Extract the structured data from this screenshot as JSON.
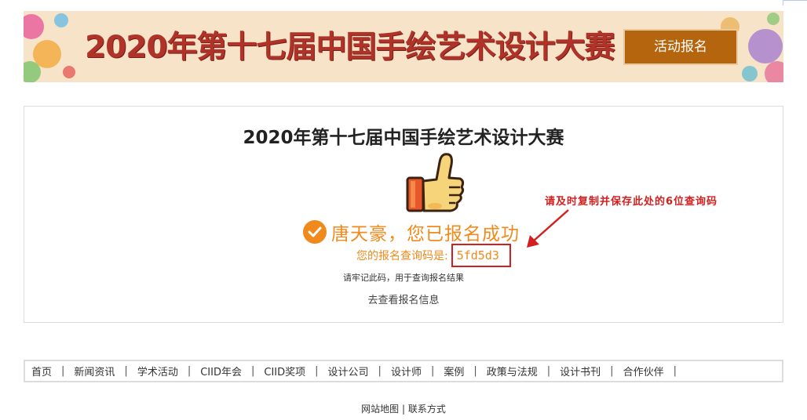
{
  "banner": {
    "title": "2020年第十七届中国手绘艺术设计大赛",
    "button_label": "活动报名",
    "colors": {
      "background": "#f6e3c8",
      "title": "#b0332a",
      "button": "#b5650d"
    }
  },
  "result": {
    "title": "2020年第十七届中国手绘艺术设计大赛",
    "success_message": "唐天豪，您已报名成功",
    "code_label": "您的报名查询码是:",
    "code_value": "5fd5d3",
    "note": "请牢记此码，用于查询报名结果",
    "view_link": "去查看报名信息",
    "annotation": "请及时复制并保存此处的6位查询码",
    "icons": [
      "thumbs-up-icon",
      "checkmark-icon",
      "arrow-icon"
    ],
    "colors": {
      "accent": "#f08a1c",
      "annotation": "#d22020"
    }
  },
  "footer_nav": {
    "items": [
      "首页",
      "新闻资讯",
      "学术活动",
      "CIID年会",
      "CIID奖项",
      "设计公司",
      "设计师",
      "案例",
      "政策与法规",
      "设计书刊",
      "合作伙伴"
    ],
    "separator": "|"
  },
  "bottom_links": {
    "sitemap": "网站地图",
    "separator": "|",
    "contact": "联系方式"
  }
}
